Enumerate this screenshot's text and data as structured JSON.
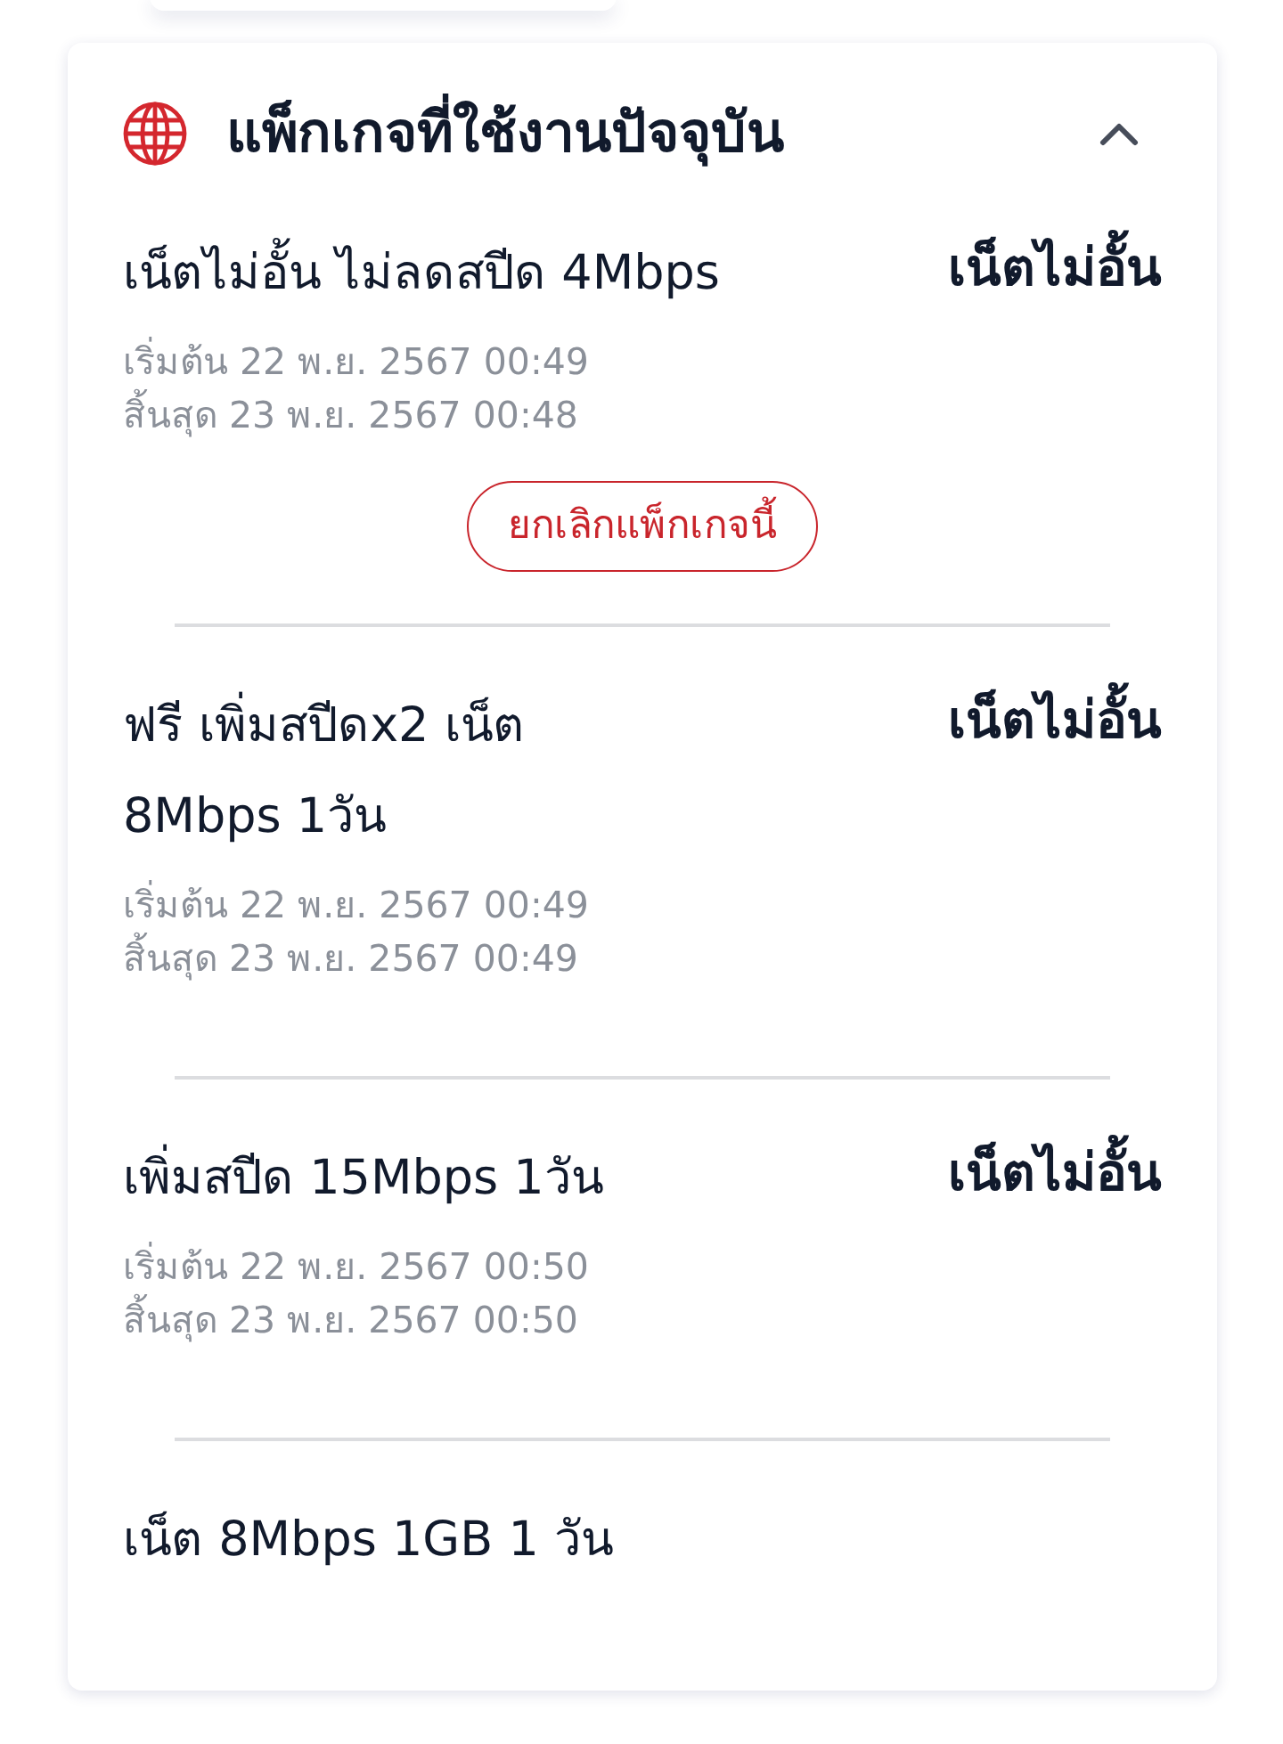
{
  "section": {
    "title": "แพ็กเกจที่ใช้งานปัจจุบัน",
    "expanded": true
  },
  "packages": [
    {
      "name": "เน็ตไม่อั้น ไม่ลดสปีด 4Mbps",
      "type_label": "เน็ตไม่อั้น",
      "start": "เริ่มต้น 22 พ.ย. 2567 00:49",
      "end": "สิ้นสุด 23 พ.ย. 2567 00:48",
      "action": "ยกเลิกแพ็กเกจนี้"
    },
    {
      "name": "ฟรี เพิ่มสปีดx2 เน็ต\n8Mbps 1วัน",
      "type_label": "เน็ตไม่อั้น",
      "start": "เริ่มต้น 22 พ.ย. 2567 00:49",
      "end": "สิ้นสุด 23 พ.ย. 2567 00:49"
    },
    {
      "name": "เพิ่มสปีด 15Mbps 1วัน",
      "type_label": "เน็ตไม่อั้น",
      "start": "เริ่มต้น 22 พ.ย. 2567 00:50",
      "end": "สิ้นสุด 23 พ.ย. 2567 00:50"
    },
    {
      "name": "เน็ต 8Mbps 1GB 1 วัน"
    }
  ]
}
